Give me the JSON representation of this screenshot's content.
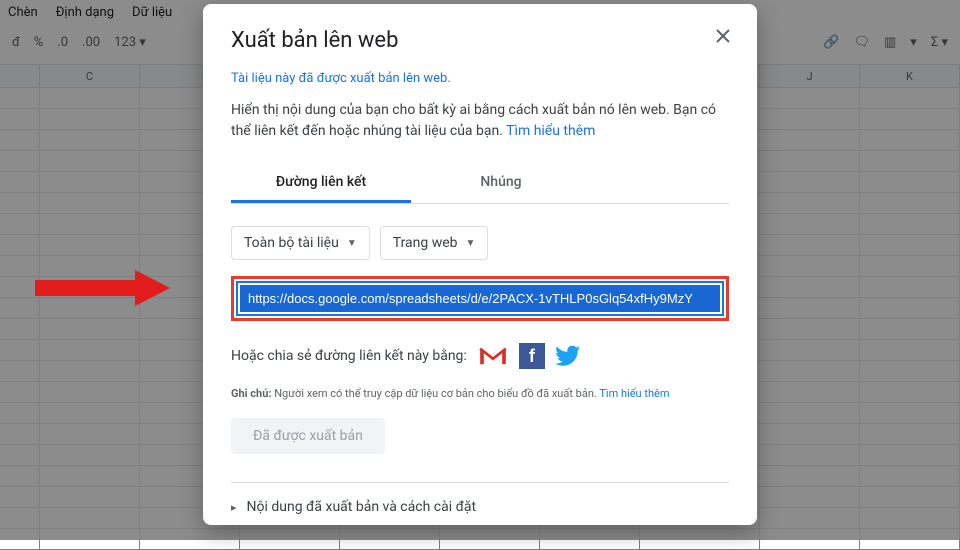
{
  "menu": {
    "insert": "Chèn",
    "format": "Định dạng",
    "data": "Dữ liệu"
  },
  "toolbar": {
    "currency": "đ",
    "percent": "%",
    "dec_dec": ".0",
    "dec_inc": ".00",
    "number_format": "123"
  },
  "columns": [
    "",
    "C",
    "",
    "",
    "",
    "",
    "",
    "J",
    "K"
  ],
  "dialog": {
    "title": "Xuất bản lên web",
    "published_note": "Tài liệu này đã được xuất bản lên web.",
    "desc_main": "Hiển thị nội dung của bạn cho bất kỳ ai bằng cách xuất bản nó lên web. Bạn có thể liên kết đến hoặc nhúng tài liệu của bạn. ",
    "learn_more": "Tìm hiểu thêm",
    "tabs": {
      "link": "Đường liên kết",
      "embed": "Nhúng"
    },
    "selector_doc": "Toàn bộ tài liệu",
    "selector_format": "Trang web",
    "url": "https://docs.google.com/spreadsheets/d/e/2PACX-1vTHLP0sGlq54xfHy9MzY",
    "share_label": "Hoặc chia sẻ đường liên kết này bằng:",
    "footnote_label": "Ghi chú:",
    "footnote_text": " Người xem có thể truy cập dữ liệu cơ bản cho biểu đồ đã xuất bản. ",
    "published_button": "Đã được xuất bản",
    "expand_label": "Nội dung đã xuất bản và cách cài đặt"
  }
}
